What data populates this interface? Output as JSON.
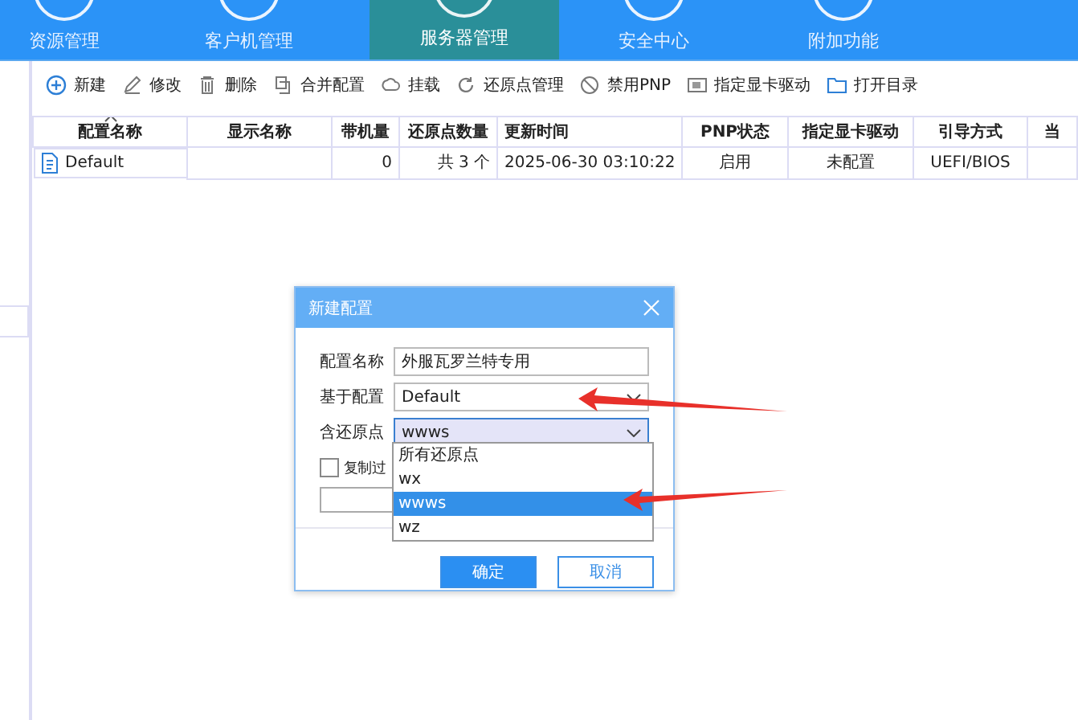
{
  "nav": {
    "tabs": [
      {
        "label": "资源管理",
        "selected": false
      },
      {
        "label": "客户机管理",
        "selected": false
      },
      {
        "label": "服务器管理",
        "selected": true
      },
      {
        "label": "安全中心",
        "selected": false
      },
      {
        "label": "附加功能",
        "selected": false
      }
    ]
  },
  "toolbar": {
    "buttons": [
      {
        "label": "新建",
        "kind": "add"
      },
      {
        "label": "修改",
        "kind": "edit"
      },
      {
        "label": "删除",
        "kind": "delete"
      },
      {
        "label": "合并配置",
        "kind": "merge"
      },
      {
        "label": "挂载",
        "kind": "mount"
      },
      {
        "label": "还原点管理",
        "kind": "restore"
      },
      {
        "label": "禁用PNP",
        "kind": "ban"
      },
      {
        "label": "指定显卡驱动",
        "kind": "gpu"
      },
      {
        "label": "打开目录",
        "kind": "folder"
      }
    ]
  },
  "table": {
    "columns": [
      "配置名称",
      "显示名称",
      "带机量",
      "还原点数量",
      "更新时间",
      "PNP状态",
      "指定显卡驱动",
      "引导方式",
      "当"
    ],
    "rows": [
      {
        "cells": [
          "Default",
          "",
          "0",
          "共 3 个",
          "2025-06-30 03:10:22",
          "启用",
          "未配置",
          "UEFI/BIOS",
          ""
        ]
      }
    ]
  },
  "dialog": {
    "title": "新建配置",
    "fields": [
      {
        "label": "配置名称",
        "kind": "text",
        "value": "外服瓦罗兰特专用"
      },
      {
        "label": "基于配置",
        "kind": "select",
        "value": "Default"
      },
      {
        "label": "含还原点",
        "kind": "select",
        "value": "wwws",
        "open": true
      }
    ],
    "checkbox": {
      "label": "复制过",
      "checked": false
    },
    "options": [
      {
        "label": "所有还原点",
        "selected": false
      },
      {
        "label": "wx",
        "selected": false
      },
      {
        "label": "wwws",
        "selected": true
      },
      {
        "label": "wz",
        "selected": false
      }
    ],
    "buttons": [
      {
        "label": "确定",
        "kind": "primary"
      },
      {
        "label": "取消",
        "kind": "secondary"
      }
    ]
  }
}
